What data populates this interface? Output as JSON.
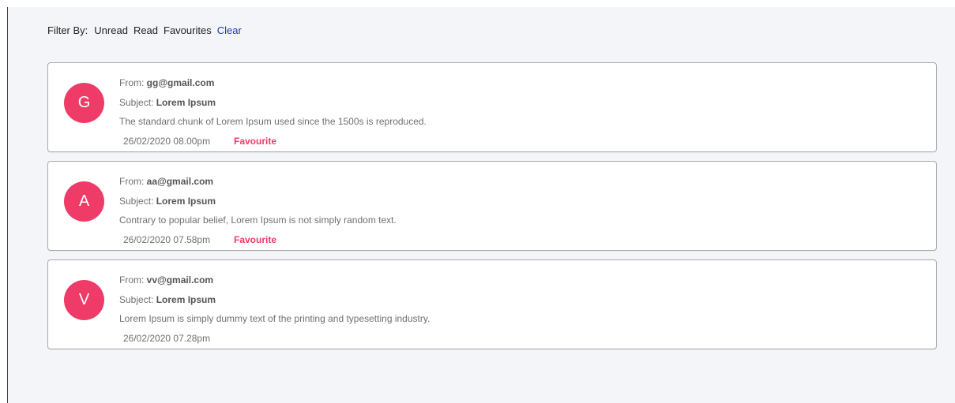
{
  "filter": {
    "label": "Filter By:",
    "options": [
      "Unread",
      "Read",
      "Favourites"
    ],
    "clear": "Clear"
  },
  "emails": [
    {
      "initial": "G",
      "from_label": "From: ",
      "from": "gg@gmail.com",
      "subject_label": "Subject: ",
      "subject": "Lorem Ipsum",
      "body": "The standard chunk of Lorem Ipsum used since the 1500s is reproduced.",
      "date": "26/02/2020 08.00pm",
      "favourite": "Favourite"
    },
    {
      "initial": "A",
      "from_label": "From: ",
      "from": "aa@gmail.com",
      "subject_label": "Subject: ",
      "subject": "Lorem Ipsum",
      "body": "Contrary to popular belief, Lorem Ipsum is not simply random text.",
      "date": "26/02/2020 07.58pm",
      "favourite": "Favourite"
    },
    {
      "initial": "V",
      "from_label": "From: ",
      "from": "vv@gmail.com",
      "subject_label": "Subject: ",
      "subject": "Lorem Ipsum",
      "body": "Lorem Ipsum is simply dummy text of the printing and typesetting industry.",
      "date": "26/02/2020 07.28pm",
      "favourite": ""
    }
  ],
  "colors": {
    "accent": "#ee3b67",
    "link": "#2233cc",
    "background": "#f4f5f8"
  }
}
